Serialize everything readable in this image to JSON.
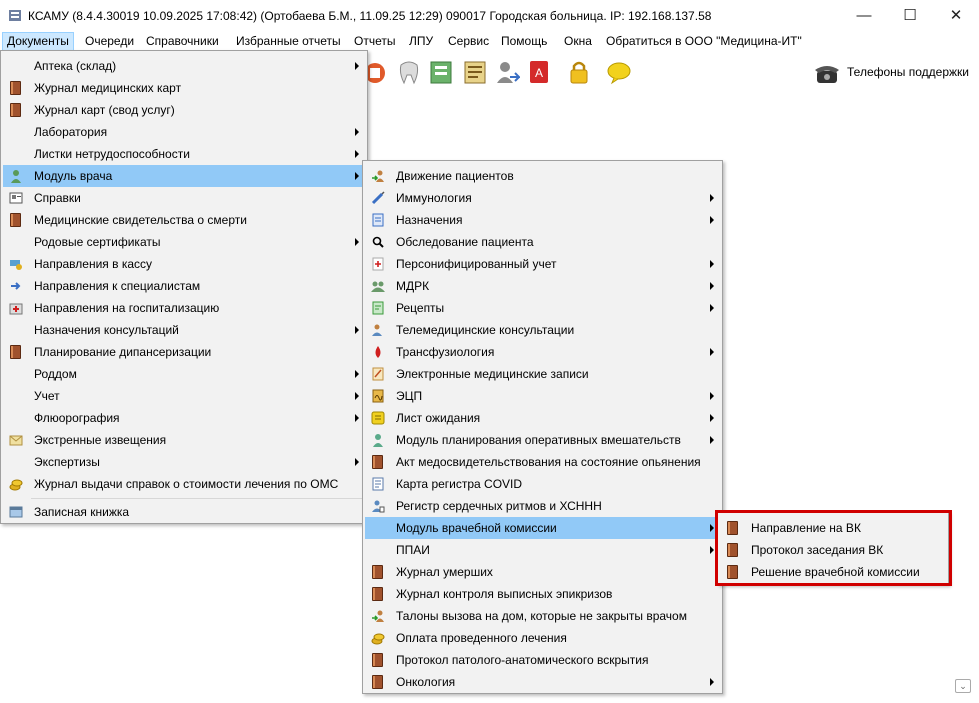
{
  "window": {
    "title": "КСАМУ (8.4.4.30019 10.09.2025 17:08:42) (Ортобаева Б.М., 11.09.25 12:29)  090017 Городская больница. IP: 192.168.137.58",
    "minimize": "—",
    "maximize": "☐",
    "close": "✕"
  },
  "menubar": [
    "Документы",
    "Очереди",
    "Справочники",
    "Избранные отчеты",
    "Отчеты",
    "ЛПУ",
    "Сервис",
    "Помощь",
    "Окна",
    "Обратиться в ООО \"Медицина-ИТ\""
  ],
  "toolbar": {
    "support_label": "Телефоны поддержки",
    "icons": [
      "calendar-icon",
      "tooth-icon",
      "medical-chart-icon",
      "patient-transfer-icon",
      "pdf-document-icon",
      "lock-icon",
      "message-icon"
    ]
  },
  "menu_documents": [
    {
      "label": "Аптека (склад)",
      "icon": "",
      "submenu": true
    },
    {
      "label": "Журнал медицинских карт",
      "icon": "book-icon",
      "submenu": false
    },
    {
      "label": "Журнал карт (свод услуг)",
      "icon": "book-icon",
      "submenu": false
    },
    {
      "label": "Лаборатория",
      "icon": "",
      "submenu": true
    },
    {
      "label": "Листки нетрудоспособности",
      "icon": "",
      "submenu": true
    },
    {
      "label": "Модуль врача",
      "icon": "doctor-icon",
      "submenu": true,
      "highlighted": true
    },
    {
      "label": "Справки",
      "icon": "certificate-icon",
      "submenu": false
    },
    {
      "label": "Медицинские свидетельства о смерти",
      "icon": "book-icon",
      "submenu": false
    },
    {
      "label": "Родовые сертификаты",
      "icon": "",
      "submenu": true
    },
    {
      "label": "Направления в кассу",
      "icon": "cashier-icon",
      "submenu": false
    },
    {
      "label": "Направления к специалистам",
      "icon": "arrow-right-icon",
      "submenu": false
    },
    {
      "label": "Направления на госпитализацию",
      "icon": "hospital-icon",
      "submenu": false
    },
    {
      "label": "Назначения консультаций",
      "icon": "",
      "submenu": true
    },
    {
      "label": "Планирование дипансеризации",
      "icon": "book-icon",
      "submenu": false
    },
    {
      "label": "Роддом",
      "icon": "",
      "submenu": true
    },
    {
      "label": "Учет",
      "icon": "",
      "submenu": true
    },
    {
      "label": "Флюорография",
      "icon": "",
      "submenu": true
    },
    {
      "label": "Экстренные извещения",
      "icon": "envelope-icon",
      "submenu": false
    },
    {
      "label": "Экспертизы",
      "icon": "",
      "submenu": true
    },
    {
      "label": "Журнал выдачи справок о стоимости лечения по ОМС",
      "icon": "coins-icon",
      "submenu": false
    },
    {
      "label": "Записная книжка",
      "icon": "notebook-icon",
      "submenu": false,
      "separator_before": true
    }
  ],
  "menu_doctor": [
    {
      "label": "Движение пациентов",
      "icon": "patient-transfer-icon",
      "submenu": false
    },
    {
      "label": "Иммунология",
      "icon": "syringe-icon",
      "submenu": true
    },
    {
      "label": "Назначения",
      "icon": "prescription-icon",
      "submenu": true
    },
    {
      "label": "Обследование пациента",
      "icon": "search-icon",
      "submenu": false
    },
    {
      "label": "Персонифицированный учет",
      "icon": "medical-card-icon",
      "submenu": true
    },
    {
      "label": "МДРК",
      "icon": "group-icon",
      "submenu": true
    },
    {
      "label": "Рецепты",
      "icon": "recipe-icon",
      "submenu": true
    },
    {
      "label": "Телемедицинские консультации",
      "icon": "telemedicine-icon",
      "submenu": false
    },
    {
      "label": "Трансфузиология",
      "icon": "blood-drop-icon",
      "submenu": true
    },
    {
      "label": "Электронные медицинские записи",
      "icon": "notepad-icon",
      "submenu": false
    },
    {
      "label": "ЭЦП",
      "icon": "signature-icon",
      "submenu": true
    },
    {
      "label": "Лист ожидания",
      "icon": "list-icon",
      "submenu": true
    },
    {
      "label": "Модуль планирования оперативных вмешательств",
      "icon": "surgeon-icon",
      "submenu": true
    },
    {
      "label": "Акт медосвидетельствования на состояние опьянения",
      "icon": "book-icon",
      "submenu": false
    },
    {
      "label": "Карта регистра COVID",
      "icon": "covid-card-icon",
      "submenu": false
    },
    {
      "label": "Регистр сердечных ритмов и ХСННН",
      "icon": "heart-registry-icon",
      "submenu": false
    },
    {
      "label": "Модуль врачебной комиссии",
      "icon": "",
      "submenu": true,
      "highlighted": true
    },
    {
      "label": "ППАИ",
      "icon": "",
      "submenu": true
    },
    {
      "label": "Журнал умерших",
      "icon": "book-icon",
      "submenu": false
    },
    {
      "label": "Журнал контроля выписных эпикризов",
      "icon": "book-icon",
      "submenu": false
    },
    {
      "label": "Талоны вызова на дом, которые не закрыты врачом",
      "icon": "patient-transfer-icon",
      "submenu": false
    },
    {
      "label": "Оплата проведенного лечения",
      "icon": "coins-icon",
      "submenu": false
    },
    {
      "label": "Протокол патолого-анатомического вскрытия",
      "icon": "book-icon",
      "submenu": false
    },
    {
      "label": "Онкология",
      "icon": "book-icon",
      "submenu": true
    }
  ],
  "menu_commission": [
    {
      "label": "Направление на ВК",
      "icon": "book-icon"
    },
    {
      "label": "Протокол заседания ВК",
      "icon": "book-icon"
    },
    {
      "label": "Решение врачебной комиссии",
      "icon": "book-icon"
    }
  ],
  "colors": {
    "menu_highlight": "#91c9f7",
    "menubar_active": "#cce8ff",
    "annotation": "#d00000",
    "book": "#a0522d"
  }
}
